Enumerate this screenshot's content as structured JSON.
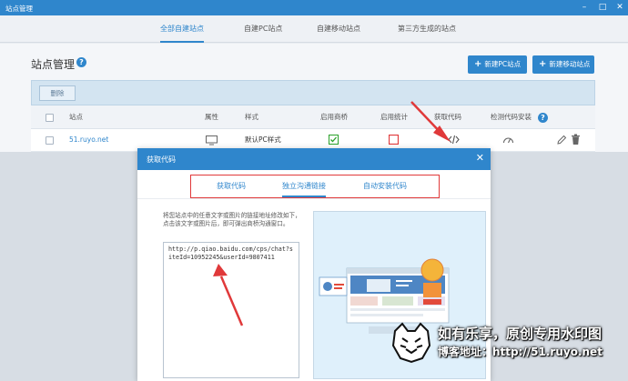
{
  "window": {
    "title": "站点管理"
  },
  "tabs": [
    {
      "label": "全部自建站点",
      "active": true
    },
    {
      "label": "自建PC站点",
      "active": false
    },
    {
      "label": "自建移动站点",
      "active": false
    },
    {
      "label": "第三方生成的站点",
      "active": false
    }
  ],
  "page": {
    "title": "站点管理",
    "new_pc_label": "新建PC站点",
    "new_mobile_label": "新建移动站点",
    "delete_label": "删除"
  },
  "table": {
    "headers": {
      "site": "站点",
      "attr": "属性",
      "style": "样式",
      "enable_bridge": "启用商桥",
      "enable_stats": "启用统计",
      "get_code": "获取代码",
      "detect_code": "检测代码安装"
    },
    "rows": [
      {
        "site": "51.ruyo.net",
        "style": "默认PC样式"
      }
    ]
  },
  "dialog": {
    "title": "获取代码",
    "tabs": [
      {
        "label": "获取代码",
        "active": false
      },
      {
        "label": "独立沟通链接",
        "active": true
      },
      {
        "label": "自动安装代码",
        "active": false
      }
    ],
    "description": "将您站点中的任意文字或图片的链接地址修改如下，点击该文字或图片后，即可弹出商桥沟通窗口。",
    "code": "http://p.qiao.baidu.com/cps/chat?siteId=10952245&userId=9807411"
  },
  "watermark": {
    "line1": "如有乐享，原创专用水印图",
    "line2": "博客地址：http://51.ruyo.net"
  },
  "colors": {
    "accent": "#2f86cc",
    "highlight": "#e0393a",
    "enabled": "#2aa12a"
  }
}
